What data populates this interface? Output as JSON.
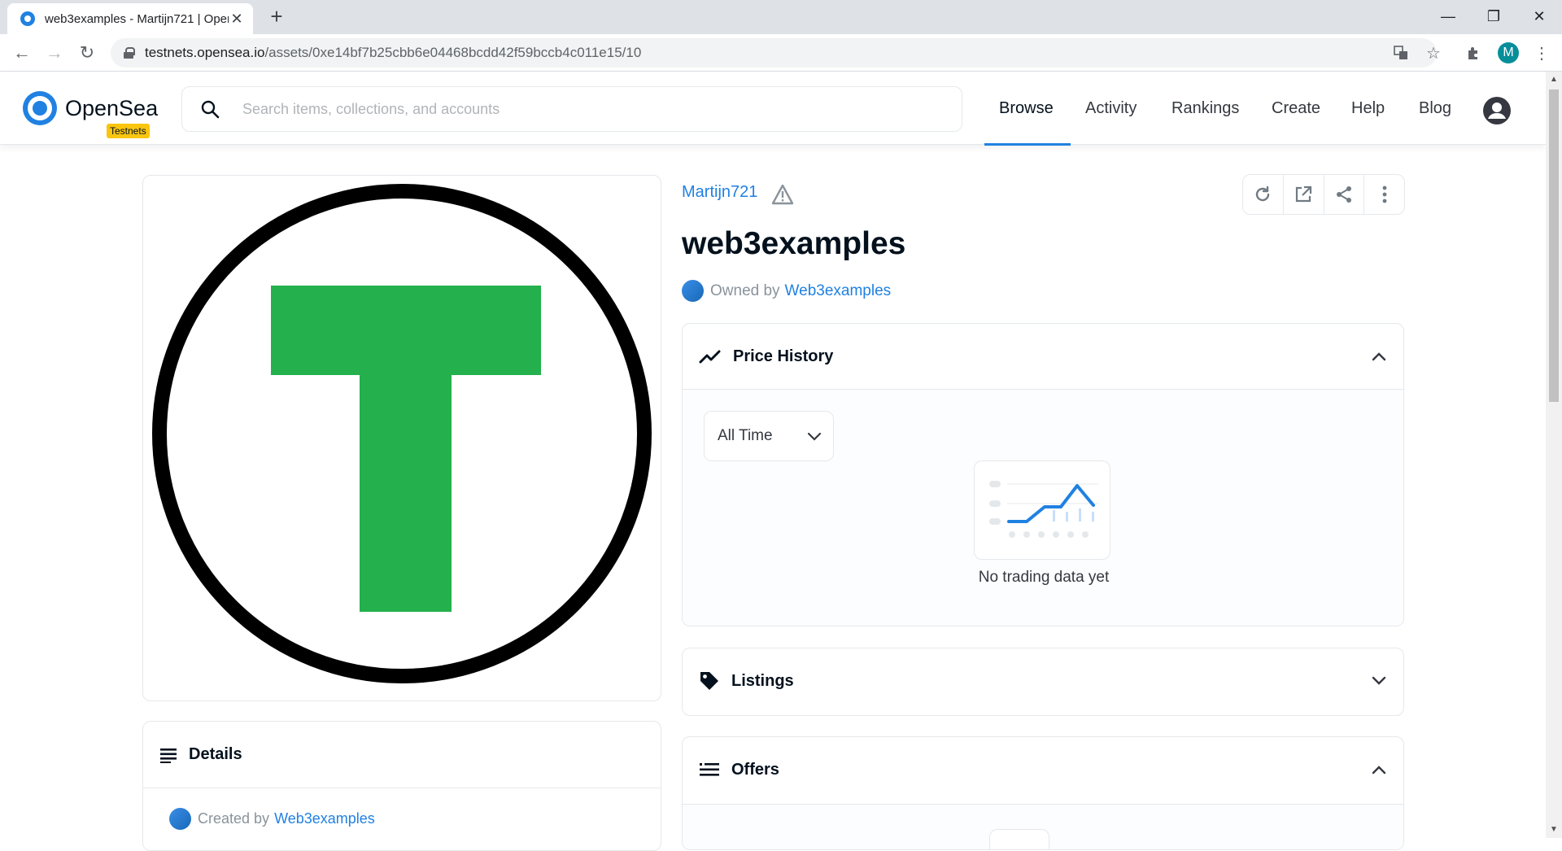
{
  "browser": {
    "tab_title": "web3examples - Martijn721 | OpenSea",
    "url_host": "testnets.opensea.io",
    "url_path": "/assets/0xe14bf7b25cbb6e04468bcdd42f59bccb4c011e15/10",
    "profile_initial": "M"
  },
  "header": {
    "brand": "OpenSea",
    "badge": "Testnets",
    "search_placeholder": "Search items, collections, and accounts",
    "nav": [
      "Browse",
      "Activity",
      "Rankings",
      "Create",
      "Help",
      "Blog"
    ],
    "active_nav": "Browse"
  },
  "asset": {
    "collection": "Martijn721",
    "name": "web3examples",
    "owned_by_label": "Owned by",
    "owner": "Web3examples",
    "image_letter": "T"
  },
  "price_history": {
    "title": "Price History",
    "time_filter": "All Time",
    "empty_text": "No trading data yet"
  },
  "listings": {
    "title": "Listings"
  },
  "offers": {
    "title": "Offers"
  },
  "details": {
    "title": "Details",
    "created_by_label": "Created by",
    "creator": "Web3examples"
  },
  "colors": {
    "accent": "#2081e2",
    "badge": "#f9c50f",
    "token_green": "#24b14d"
  }
}
